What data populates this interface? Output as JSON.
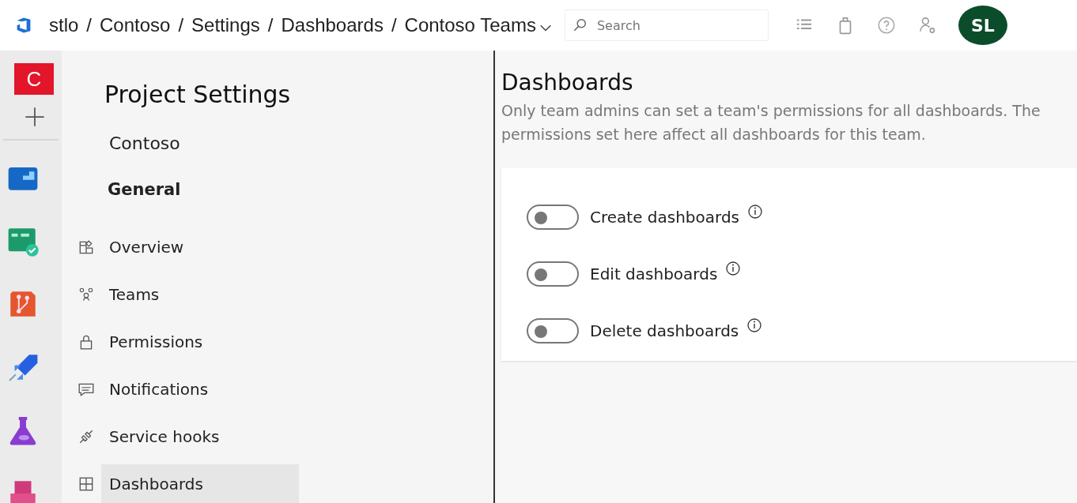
{
  "breadcrumb": {
    "items": [
      {
        "label": "stlo"
      },
      {
        "label": "Contoso"
      },
      {
        "label": "Settings"
      },
      {
        "label": "Dashboards"
      },
      {
        "label": "Contoso Teams",
        "dropdown": true
      }
    ],
    "separator": "/"
  },
  "search": {
    "placeholder": "Search"
  },
  "avatar": {
    "initials": "SL"
  },
  "rail": {
    "project_letter": "C",
    "apps": [
      {
        "kind": "overview"
      },
      {
        "kind": "boards"
      },
      {
        "kind": "repos"
      },
      {
        "kind": "pipelines"
      },
      {
        "kind": "testplans"
      },
      {
        "kind": "artifacts"
      }
    ]
  },
  "nav": {
    "title": "Project Settings",
    "project": "Contoso",
    "section": "General",
    "items": [
      {
        "label": "Overview",
        "kind": "overview",
        "selected": false
      },
      {
        "label": "Teams",
        "kind": "teams",
        "selected": false
      },
      {
        "label": "Permissions",
        "kind": "lock",
        "selected": false
      },
      {
        "label": "Notifications",
        "kind": "chat",
        "selected": false
      },
      {
        "label": "Service hooks",
        "kind": "plug",
        "selected": false
      },
      {
        "label": "Dashboards",
        "kind": "grid",
        "selected": true
      }
    ]
  },
  "page": {
    "title": "Dashboards",
    "description": "Only team admins can set a team's permissions for all dashboards. The permissions set here affect all dashboards for this team.",
    "toggles": [
      {
        "label": "Create dashboards",
        "on": false
      },
      {
        "label": "Edit dashboards",
        "on": false
      },
      {
        "label": "Delete dashboards",
        "on": false
      }
    ]
  }
}
